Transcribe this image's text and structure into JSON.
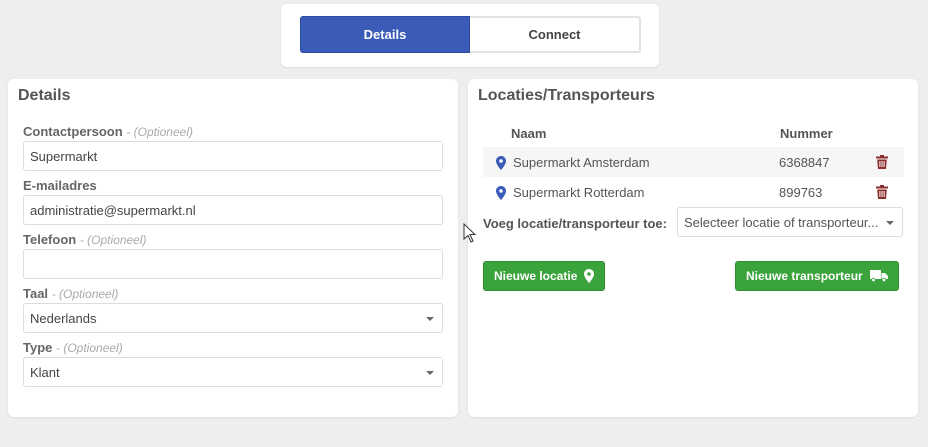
{
  "tabs": [
    {
      "label": "Details",
      "active": true
    },
    {
      "label": "Connect",
      "active": false
    }
  ],
  "details": {
    "title": "Details",
    "fields": [
      {
        "label": "Contactpersoon",
        "optional": "- (Optioneel)",
        "value": "Supermarkt"
      },
      {
        "label": "E-mailadres",
        "optional": "",
        "value": "administratie@supermarkt.nl"
      },
      {
        "label": "Telefoon",
        "optional": "- (Optioneel)",
        "value": ""
      },
      {
        "label": "Taal",
        "optional": "- (Optioneel)",
        "value": "Nederlands"
      },
      {
        "label": "Type",
        "optional": "- (Optioneel)",
        "value": "Klant"
      }
    ]
  },
  "locations": {
    "title": "Locaties/Transporteurs",
    "col_name": "Naam",
    "col_number": "Nummer",
    "rows": [
      {
        "name": "Supermarkt Amsterdam",
        "number": "6368847"
      },
      {
        "name": "Supermarkt Rotterdam",
        "number": "899763"
      }
    ],
    "add_label": "Voeg locatie/transporteur toe:",
    "add_placeholder": "Selecteer locatie of transporteur...",
    "btn_new_location": "Nieuwe locatie",
    "btn_new_transporter": "Nieuwe transporteur"
  },
  "colors": {
    "primary": "#3a5bb8",
    "success": "#3aa33c",
    "delete": "#8b2e2e",
    "pin": "#3a5bb8"
  }
}
